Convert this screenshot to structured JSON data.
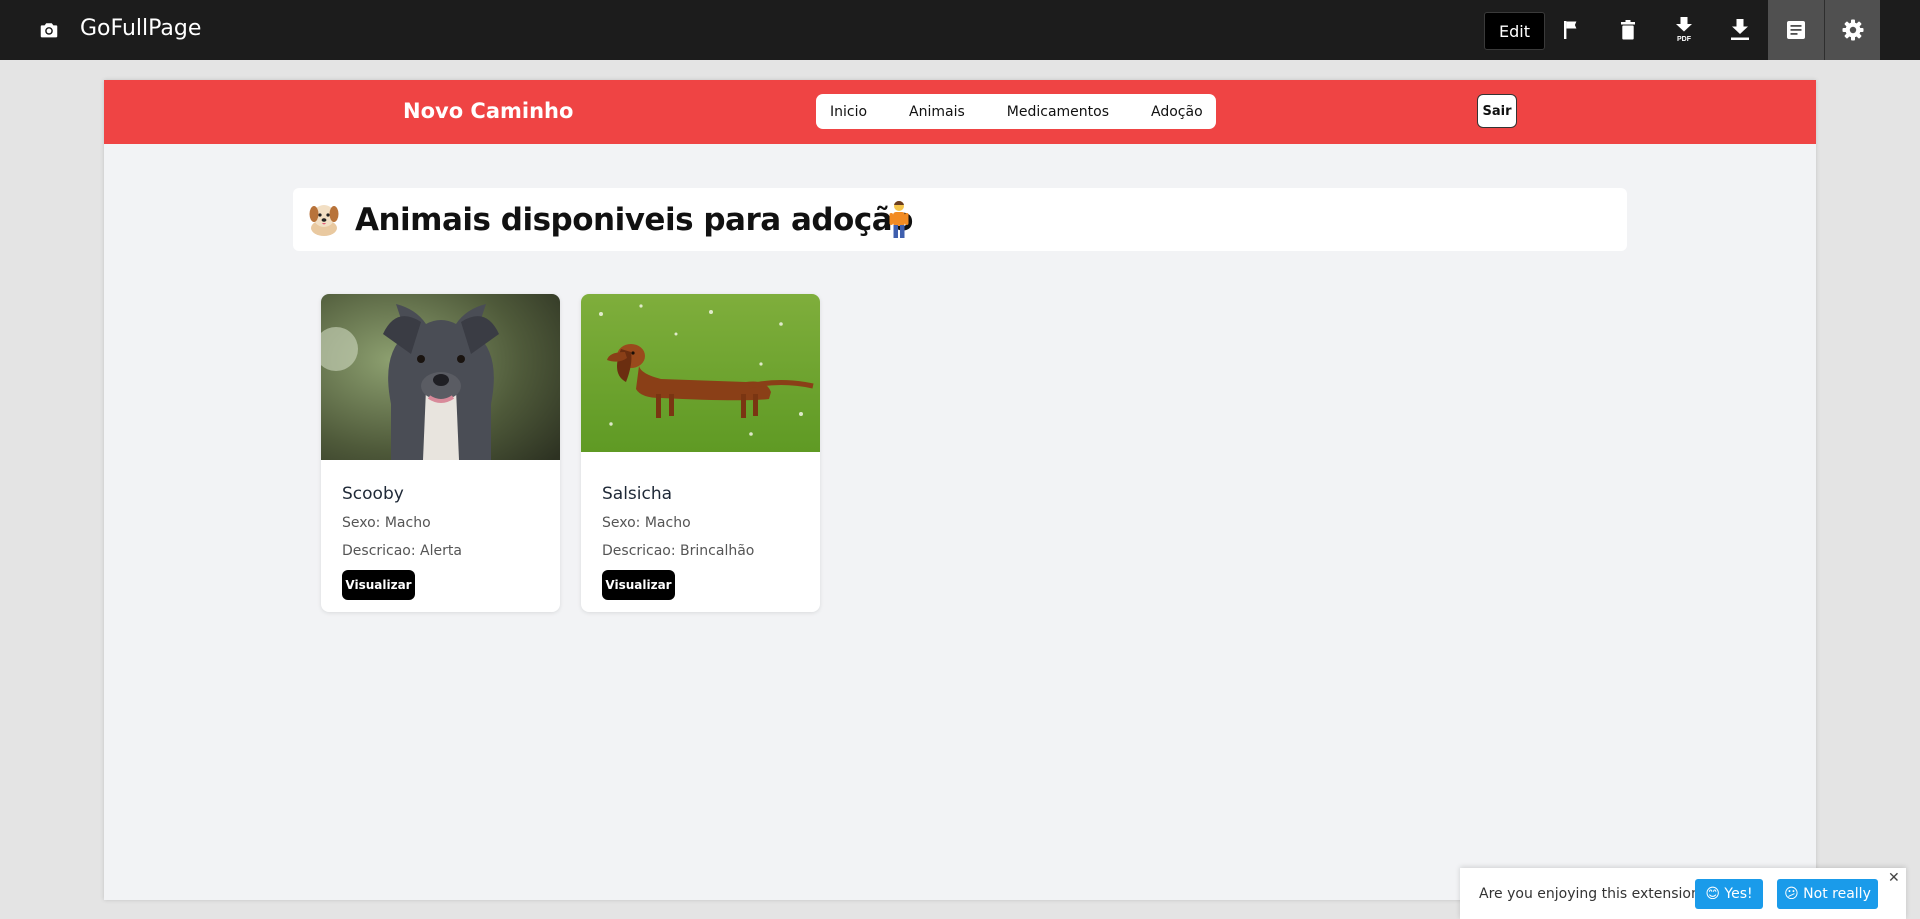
{
  "toolbar": {
    "app_title": "GoFullPage",
    "edit_label": "Edit",
    "icons": [
      "camera-icon",
      "flag-icon",
      "trash-icon",
      "download-pdf-icon",
      "download-icon",
      "notes-icon",
      "gear-icon"
    ],
    "pdf_badge": "PDF"
  },
  "site": {
    "brand": "Novo Caminho",
    "header_color": "#ef4444",
    "nav": [
      "Inicio",
      "Animais",
      "Medicamentos",
      "Adoção"
    ],
    "logout_label": "Sair"
  },
  "heading": {
    "emoji_left": "dog-emoji",
    "text": "Animais disponiveis para adoção",
    "emoji_right": "person-emoji"
  },
  "animals": [
    {
      "name": "Scooby",
      "sexo": "Sexo: Macho",
      "descricao": "Descricao: Alerta",
      "button": "Visualizar",
      "photo": "grey-pitbull-photo"
    },
    {
      "name": "Salsicha",
      "sexo": "Sexo: Macho",
      "descricao": "Descricao: Brincalhão",
      "button": "Visualizar",
      "photo": "dachshund-on-grass-photo"
    }
  ],
  "feedback": {
    "question": "Are you enjoying this extension?",
    "yes_label": "😊 Yes!",
    "no_label": "😕 Not really",
    "close": "✕",
    "button_color": "#1a9bea"
  }
}
